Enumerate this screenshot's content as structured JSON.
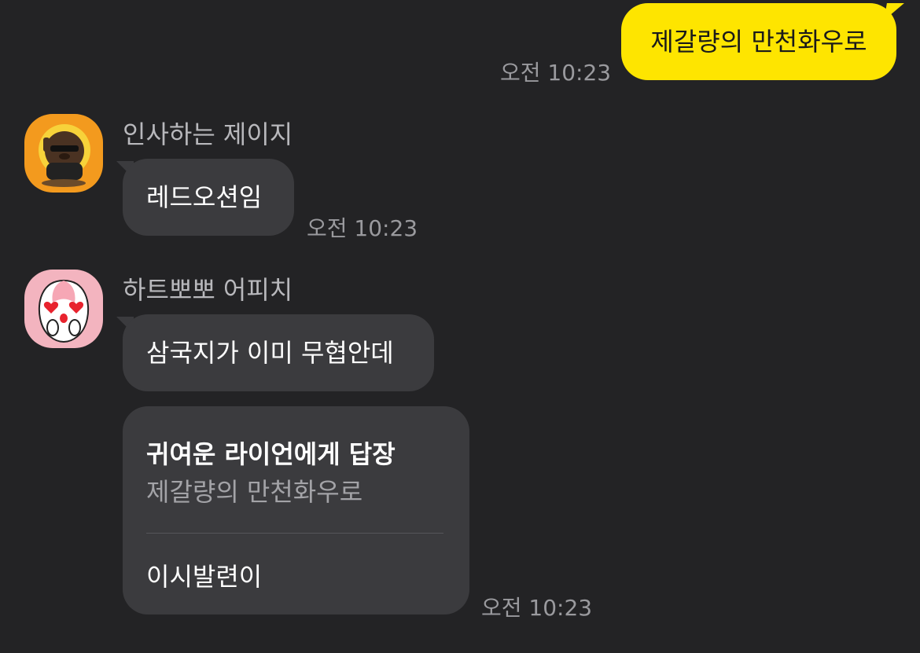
{
  "colors": {
    "background": "#232325",
    "outgoing_bubble": "#fee500",
    "incoming_bubble": "#3b3b3e",
    "timestamp": "#9a9a9e",
    "sender_name": "#b8b8bc"
  },
  "messages": {
    "outgoing_1": {
      "text": "제갈량의 만천화우로",
      "time": "오전 10:23"
    },
    "group_1": {
      "sender": "인사하는 제이지",
      "avatar_icon": "jay-g-character-icon",
      "text": "레드오션임",
      "time": "오전 10:23"
    },
    "group_2": {
      "sender": "하트뽀뽀 어피치",
      "avatar_icon": "apeach-heart-eyes-icon",
      "text": "삼국지가 이미 무협안데",
      "reply": {
        "title": "귀여운 라이언에게 답장",
        "quoted": "제갈량의 만천화우로",
        "text": "이시발련이"
      },
      "time": "오전 10:23"
    }
  }
}
